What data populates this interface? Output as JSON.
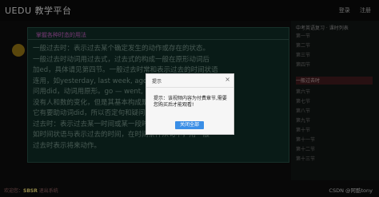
{
  "app": {
    "logo": "UEDU 教学平台"
  },
  "topbar": {
    "links": [
      "登录",
      "注册"
    ]
  },
  "main": {
    "crumb": "掌握各种时态的用法",
    "lines": [
      "一般过去时：表示过去某个确定发生的动作或存在的状态。",
      "一般过去时动词用过去式，过去式的构成一般在原形动词后",
      "加ed，具体请见第四节。一般过去时常和表示过去的时间状语",
      "连用，如yesterday, last week, ago等。对一般过去时提",
      "问用did，动词用原形。go — went, do — did",
      "没有人和数的变化，但是其基本构成是一样的，",
      "它有要助动词did，所以否定句和疑问句都要借助did。",
      "过去时：表示过去某一时间或某一段时间内的动作，",
      "如时间状语与表示过去的时间，在时间条件从句中，用一般",
      "过去时表示将来动作。"
    ]
  },
  "sidebar": {
    "title": "中考英语复习 · 课时列表",
    "items": [
      "第一节",
      "第二节",
      "第三节",
      "第四节",
      "一般过去时",
      "第六节",
      "第七节",
      "第八节",
      "第九节",
      "第十节",
      "第十一节",
      "第十二节",
      "第十三节"
    ]
  },
  "dialog": {
    "title": "提示",
    "close": "×",
    "message": "提示：该视频内容为付费章节,需要您购买后才能观看!",
    "button": "关闭全部"
  },
  "footer": {
    "prefix": "欢迎您：",
    "user": "SBSR",
    "suffix": " 退出系统",
    "watermark": "CSDN @阿酷tony"
  }
}
